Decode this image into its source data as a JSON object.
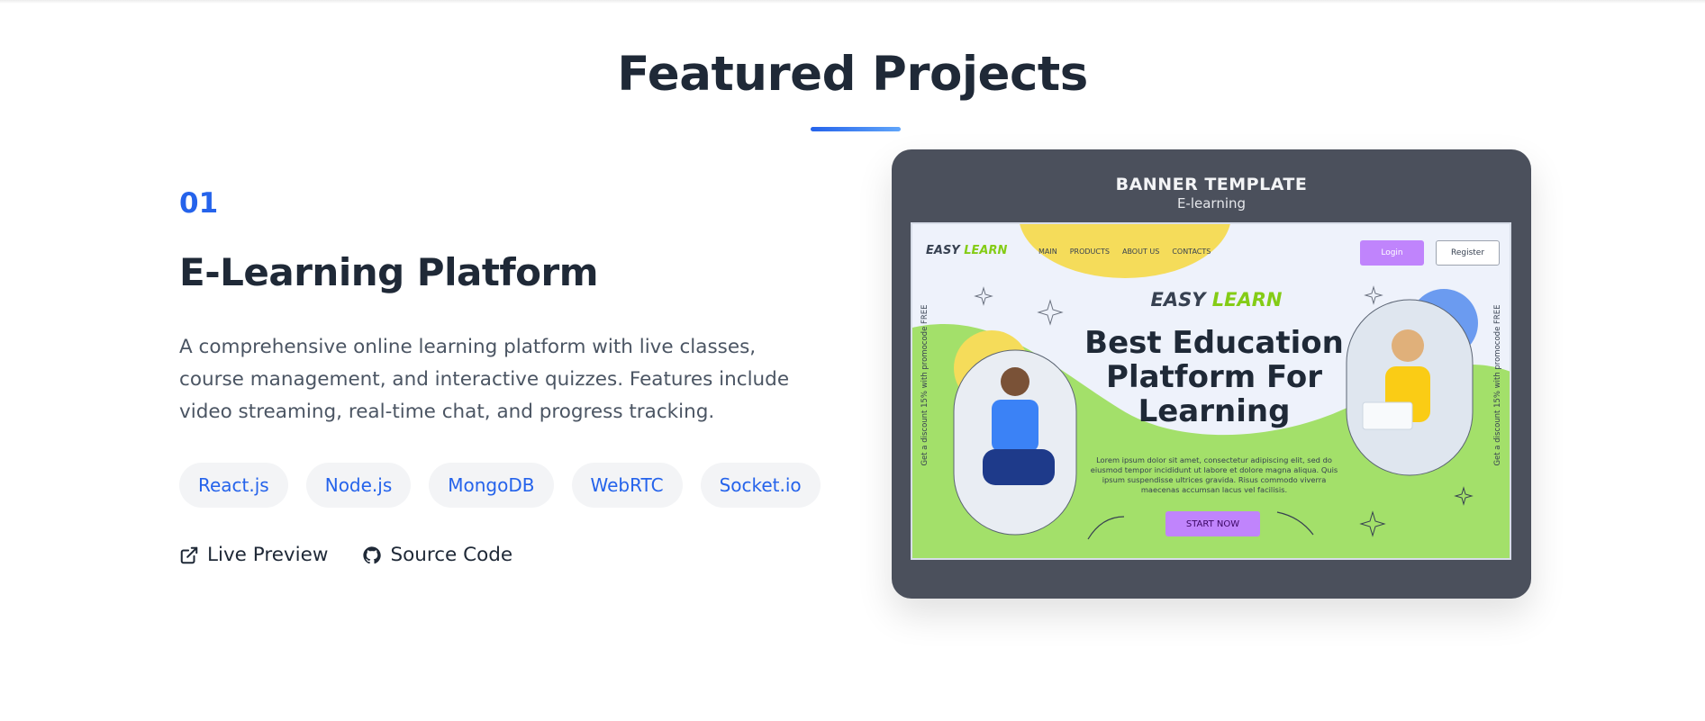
{
  "section": {
    "title": "Featured Projects"
  },
  "project": {
    "number": "01",
    "title": "E-Learning Platform",
    "description": "A comprehensive online learning platform with live classes, course management, and interactive quizzes. Features include video streaming, real-time chat, and progress tracking.",
    "tags": [
      "React.js",
      "Node.js",
      "MongoDB",
      "WebRTC",
      "Socket.io"
    ],
    "links": {
      "live_preview": "Live Preview",
      "source_code": "Source Code"
    },
    "icons": {
      "live_preview": "external-link-icon",
      "source_code": "github-icon"
    }
  },
  "preview": {
    "header_title": "BANNER TEMPLATE",
    "header_subtitle": "E-learning",
    "logo_dark": "EASY ",
    "logo_green": "LEARN",
    "nav": [
      "MAIN",
      "PRODUCTS",
      "ABOUT US",
      "CONTACTS"
    ],
    "login": "Login",
    "register": "Register",
    "headline": "Best Education Platform For Learning",
    "lorem": "Lorem ipsum dolor sit amet, consectetur adipiscing elit, sed do eiusmod tempor incididunt ut labore et dolore magna aliqua. Quis ipsum suspendisse ultrices gravida. Risus commodo viverra maecenas accumsan lacus vel facilisis.",
    "start": "START NOW",
    "side_text": "Get a discount 15% with promocode FREE"
  },
  "colors": {
    "accent": "#2563eb",
    "heading": "#1f2937",
    "body": "#4b5563",
    "tag_bg": "#f3f4f6",
    "card_bg": "#4b505c",
    "green": "#a3e06a",
    "purple": "#c084fc",
    "yellow": "#f5dc5a"
  }
}
